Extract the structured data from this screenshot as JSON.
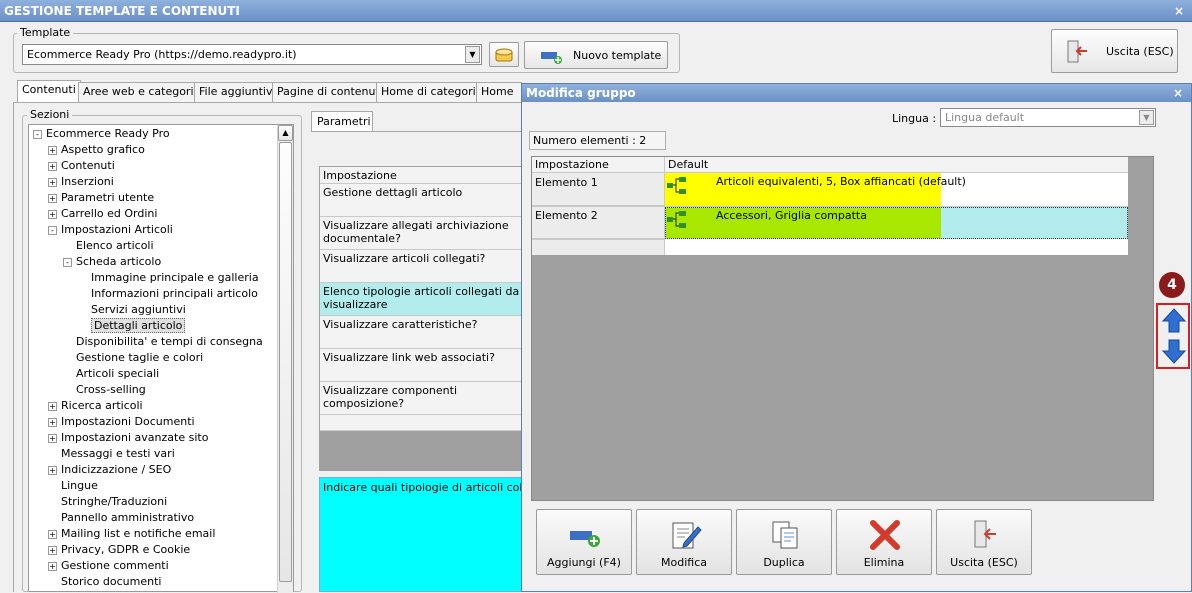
{
  "window": {
    "title": "GESTIONE TEMPLATE E CONTENUTI",
    "close": "×"
  },
  "template": {
    "group_label": "Template",
    "selected": "Ecommerce Ready Pro (https://demo.readypro.it)",
    "new_label": "Nuovo template"
  },
  "exit_label": "Uscita (ESC)",
  "tabs": [
    "Contenuti",
    "Aree web e categorie",
    "File aggiuntivi",
    "Pagine di contenuti",
    "Home di categoria",
    "Home di"
  ],
  "sections": {
    "label": "Sezioni",
    "items": [
      "Ecommerce Ready Pro",
      "Aspetto grafico",
      "Contenuti",
      "Inserzioni",
      "Parametri utente",
      "Carrello ed Ordini",
      "Impostazioni Articoli",
      "Elenco articoli",
      "Scheda articolo",
      "Immagine principale e galleria",
      "Informazioni principali articolo",
      "Servizi aggiuntivi",
      "Dettagli articolo",
      "Disponibilita' e tempi di consegna",
      "Gestione taglie e colori",
      "Articoli speciali",
      "Cross-selling",
      "Ricerca articoli",
      "Impostazioni Documenti",
      "Impostazioni avanzate sito",
      "Messaggi e testi vari",
      "Indicizzazione / SEO",
      "Lingue",
      "Stringhe/Traduzioni",
      "Pannello amministrativo",
      "Mailing list e notifiche email",
      "Privacy, GDPR e Cookie",
      "Gestione commenti",
      "Storico documenti"
    ]
  },
  "params": {
    "tab": "Parametri",
    "header": "Impostazione",
    "rows": [
      "Gestione dettagli articolo",
      "Visualizzare allegati archiviazione documentale?",
      "Visualizzare articoli collegati?",
      "Elenco tipologie articoli collegati da visualizzare",
      "Visualizzare caratteristiche?",
      "Visualizzare link web associati?",
      "Visualizzare componenti composizione?"
    ],
    "description": "Indicare quali tipologie di articoli collegati s"
  },
  "dialog": {
    "title": "Modifica gruppo",
    "close": "×",
    "lingua_label": "Lingua :",
    "lingua_value": "Lingua default",
    "count": "Numero elementi : 2",
    "col_setting": "Impostazione",
    "col_default": "Default",
    "rows": [
      {
        "name": "Elemento 1",
        "value": "Articoli equivalenti, 5, Box affiancati (default)",
        "color": "#ffff00"
      },
      {
        "name": "Elemento 2",
        "value": "Accessori, Griglia compatta",
        "color": "#a8e800"
      }
    ],
    "step_badge": "4",
    "buttons": [
      "Aggiungi (F4)",
      "Modifica",
      "Duplica",
      "Elimina",
      "Uscita (ESC)"
    ]
  },
  "colors": {
    "accent_red": "#d91e1e",
    "badge": "#8b1a1a",
    "highlight_cyan": "#00ffff",
    "row_cyan": "#b3ecec"
  },
  "icons": [
    "template-icon",
    "add-template-icon",
    "exit-icon",
    "arrow-up-icon",
    "arrow-down-icon",
    "add-icon",
    "edit-icon",
    "duplicate-icon",
    "delete-icon",
    "tree-node-icon"
  ]
}
